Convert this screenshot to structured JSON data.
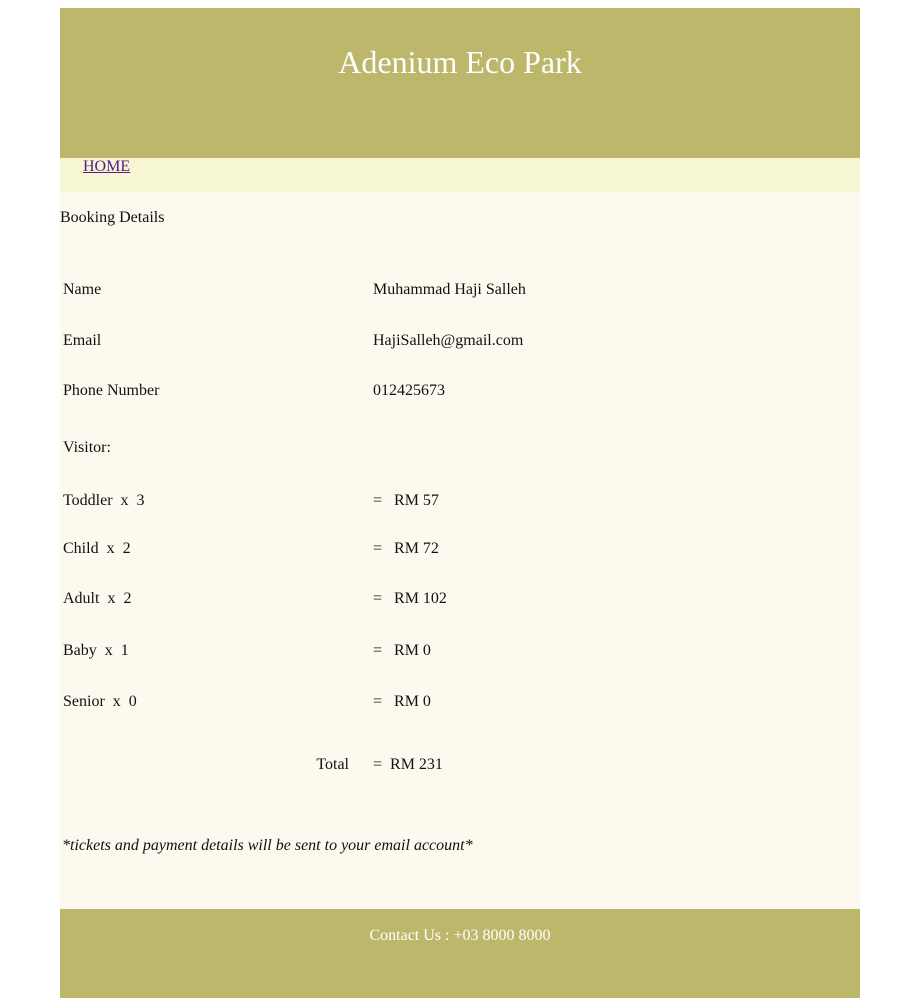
{
  "header": {
    "title": "Adenium Eco Park"
  },
  "nav": {
    "home": "HOME"
  },
  "section": {
    "title": "Booking Details"
  },
  "details": [
    {
      "label": "Name",
      "value": "Muhammad Haji Salleh"
    },
    {
      "label": "Email",
      "value": "HajiSalleh@gmail.com"
    },
    {
      "label": "Phone Number",
      "value": "012425673"
    }
  ],
  "visitor_heading": "Visitor:",
  "visitors": [
    {
      "label": "Toddler  x  3",
      "value": "=   RM 57"
    },
    {
      "label": "Child  x  2",
      "value": "=   RM 72"
    },
    {
      "label": "Adult  x  2",
      "value": "=   RM 102"
    },
    {
      "label": "Baby  x  1",
      "value": "=   RM 0"
    },
    {
      "label": "Senior  x  0",
      "value": "=   RM 0"
    }
  ],
  "total": {
    "label": "Total",
    "value": "=  RM 231"
  },
  "note": "*tickets and payment details will be sent to your email account*",
  "footer": {
    "contact": "Contact Us : +03 8000 8000"
  },
  "colors": {
    "header_bg": "#bdb76b",
    "nav_bg": "#f7f6d2",
    "page_bg": "#fdf9ef",
    "link": "#551a8b"
  }
}
